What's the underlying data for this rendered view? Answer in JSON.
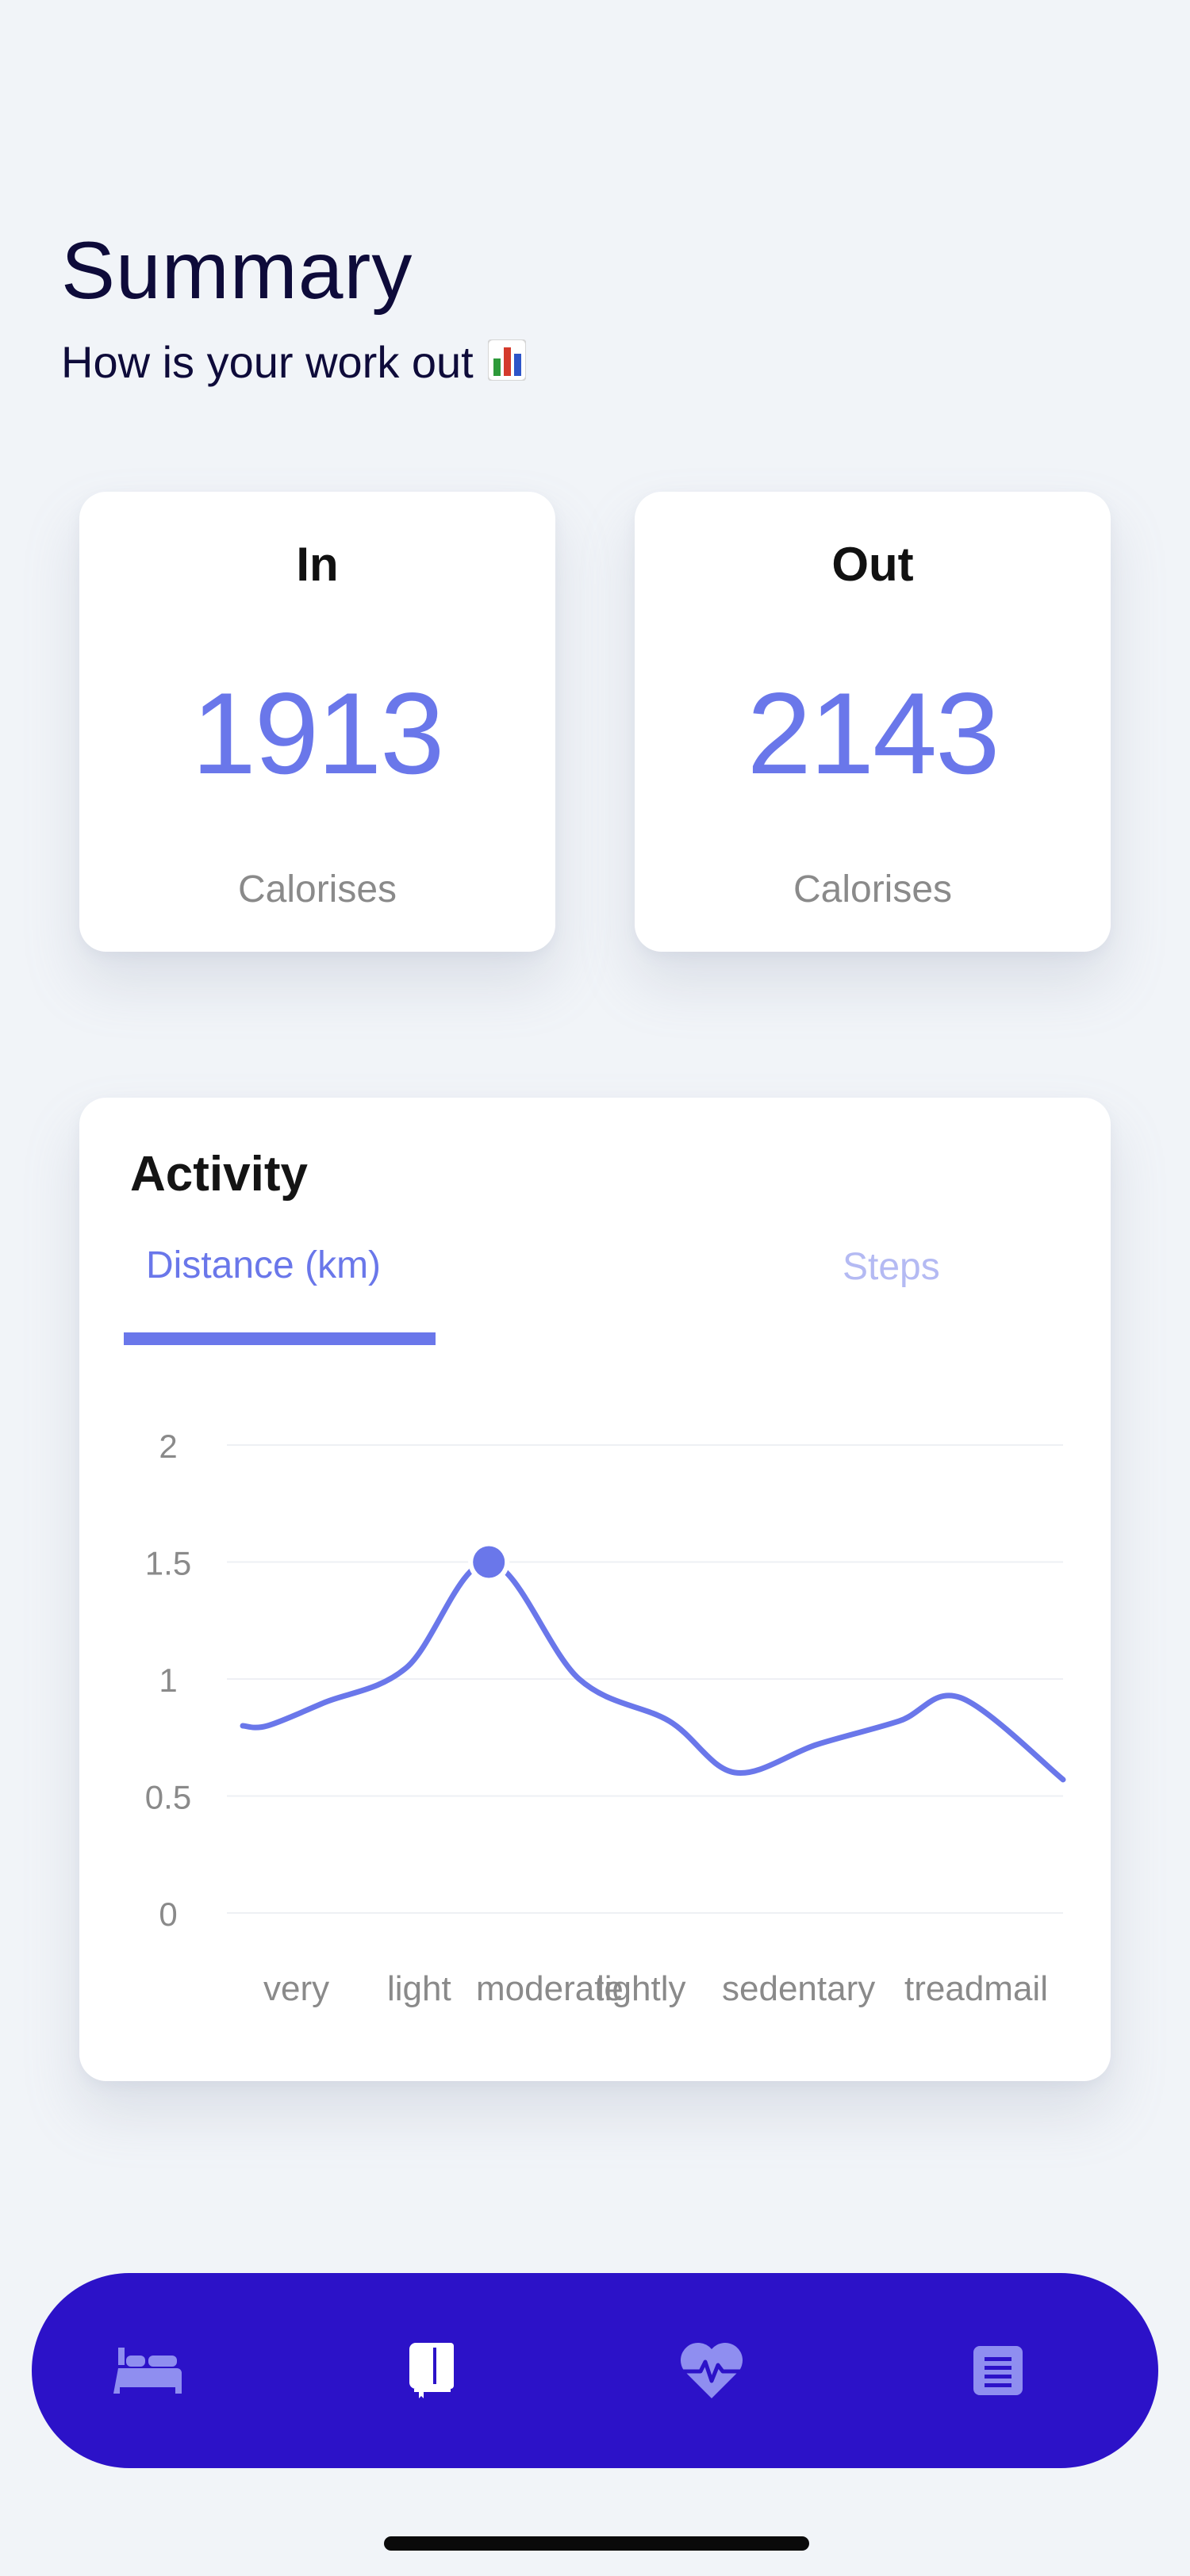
{
  "header": {
    "title": "Summary",
    "subtitle": "How is your work out",
    "subtitle_icon": "bar-chart-emoji-icon"
  },
  "stats": {
    "in": {
      "label": "In",
      "value": "1913",
      "unit": "Calorises"
    },
    "out": {
      "label": "Out",
      "value": "2143",
      "unit": "Calorises"
    }
  },
  "activity": {
    "title": "Activity",
    "tabs": [
      {
        "label": "Distance (km)",
        "active": true
      },
      {
        "label": "Steps",
        "active": false
      }
    ]
  },
  "chart_data": {
    "type": "line",
    "categories": [
      "very",
      "light",
      "moderate",
      "lightly",
      "sedentary",
      "treadmail"
    ],
    "y_ticks": [
      "2",
      "1.5",
      "1",
      "0.5",
      "0"
    ],
    "ylim": [
      0,
      2
    ],
    "x": [
      0,
      0.3,
      1.0,
      2.0,
      3.0,
      4.1,
      5.2,
      6.0,
      7.0,
      8.0,
      8.75,
      10.0
    ],
    "series": [
      {
        "values": [
          0.8,
          0.8,
          0.9,
          1.05,
          1.5,
          1.0,
          0.82,
          0.6,
          0.72,
          0.82,
          0.92,
          0.57
        ]
      }
    ],
    "highlight": {
      "x": 3.0,
      "y": 1.5
    },
    "grid": true,
    "colors": {
      "line": "#6a77ea",
      "grid": "#eef0f4",
      "tick": "#8a8a8a"
    }
  },
  "nav": {
    "items": [
      {
        "icon": "bed-icon",
        "active": false
      },
      {
        "icon": "book-icon",
        "active": true
      },
      {
        "icon": "heart-pulse-icon",
        "active": false
      },
      {
        "icon": "list-icon",
        "active": false
      }
    ],
    "colors": {
      "background": "#2c12c8",
      "active": "#ffffff",
      "inactive": "#8f8ef0"
    }
  }
}
